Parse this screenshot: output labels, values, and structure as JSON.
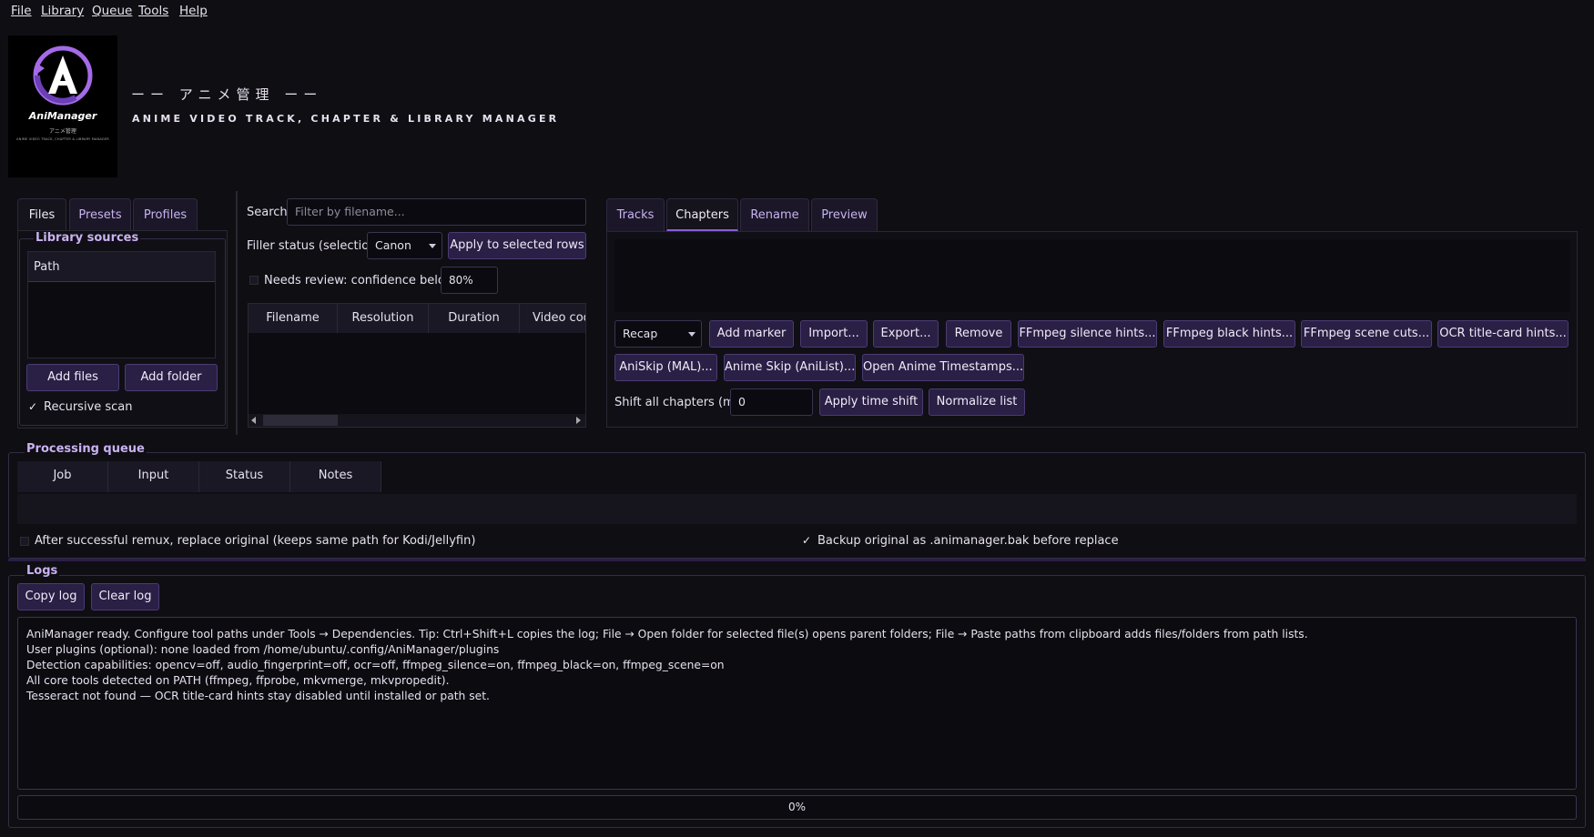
{
  "menu": {
    "file": "File",
    "library": "Library",
    "queue": "Queue",
    "tools": "Tools",
    "help": "Help"
  },
  "logo": {
    "name": "AniManager",
    "jp": "アニメ管理",
    "sub": "ANIME VIDEO TRACK, CHAPTER & LIBRARY MANAGER",
    "icon": "anime-a-logo-icon"
  },
  "header": {
    "jp_title": "ーー アニメ管理 ーー",
    "en_title": "ANIME VIDEO TRACK, CHAPTER & LIBRARY MANAGER"
  },
  "left_tabs": [
    "Files",
    "Presets",
    "Profiles"
  ],
  "library_sources": {
    "title": "Library sources",
    "column": "Path",
    "add_files": "Add files",
    "add_folder": "Add folder",
    "recursive_label": "Recursive scan",
    "recursive_checked": true
  },
  "middle": {
    "search_label": "Search",
    "search_placeholder": "Filter by filename...",
    "filler_label": "Filler status (selection)",
    "filler_value": "Canon",
    "apply_button": "Apply to selected rows",
    "needs_review_label": "Needs review: confidence below",
    "needs_review_value": "80%",
    "columns": [
      "Filename",
      "Resolution",
      "Duration",
      "Video cod"
    ]
  },
  "right_tabs": [
    "Tracks",
    "Chapters",
    "Rename",
    "Preview"
  ],
  "chapters": {
    "marker_type": "Recap",
    "buttons_row1": [
      "Add marker",
      "Import...",
      "Export...",
      "Remove",
      "FFmpeg silence hints...",
      "FFmpeg black hints...",
      "FFmpeg scene cuts...",
      "OCR title-card hints..."
    ],
    "buttons_row2": [
      "AniSkip (MAL)...",
      "Anime Skip (AniList)...",
      "Open Anime Timestamps..."
    ],
    "shift_label": "Shift all chapters (ms)",
    "shift_value": "0",
    "apply_time_shift": "Apply time shift",
    "normalize_list": "Normalize list"
  },
  "queue": {
    "title": "Processing queue",
    "columns": [
      "Job",
      "Input",
      "Status",
      "Notes"
    ],
    "replace_label": "After successful remux, replace original (keeps same path for Kodi/Jellyfin)",
    "replace_checked": false,
    "backup_label": "Backup original as .animanager.bak before replace",
    "backup_checked": true
  },
  "logs": {
    "title": "Logs",
    "copy_log": "Copy log",
    "clear_log": "Clear log",
    "lines": [
      "AniManager ready. Configure tool paths under Tools → Dependencies. Tip: Ctrl+Shift+L copies the log; File → Open folder for selected file(s) opens parent folders; File → Paste paths from clipboard adds files/folders from path lists.",
      "User plugins (optional): none loaded from /home/ubuntu/.config/AniManager/plugins",
      "Detection capabilities: opencv=off, audio_fingerprint=off, ocr=off, ffmpeg_silence=on, ffmpeg_black=on, ffmpeg_scene=on",
      "All core tools detected on PATH (ffmpeg, ffprobe, mkvmerge, mkvpropedit).",
      "Tesseract not found — OCR title-card hints stay disabled until installed or path set."
    ]
  },
  "progress": {
    "label": "0%",
    "value": 0
  },
  "colors": {
    "accent": "#8a5fd6",
    "button_bg": "#2a1f45",
    "group_title": "#c9b2f2",
    "background": "#0f0e13"
  }
}
